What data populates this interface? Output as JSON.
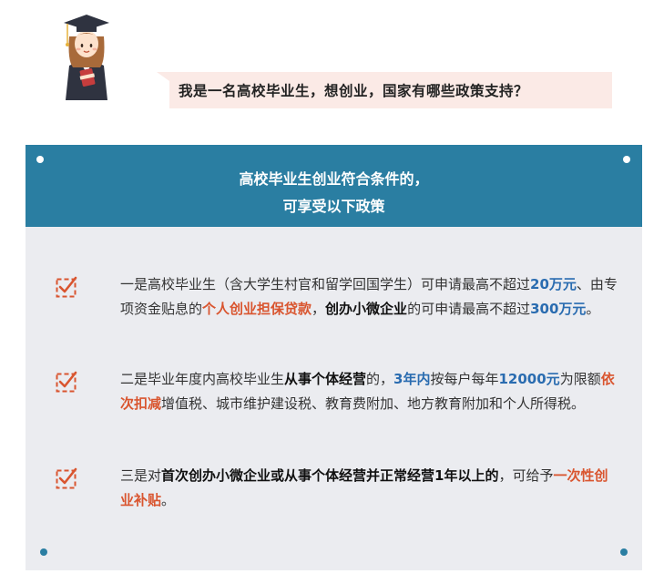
{
  "question": "我是一名高校毕业生，想创业，国家有哪些政策支持？",
  "card": {
    "title_line1": "高校毕业生创业符合条件的，",
    "title_line2": "可享受以下政策"
  },
  "items": [
    {
      "segments": [
        {
          "t": "一是高校毕业生（含大学生村官和留学回国学生）可申请最高不超过",
          "s": ""
        },
        {
          "t": "20万元",
          "s": "blue"
        },
        {
          "t": "、由专项资金贴息的",
          "s": ""
        },
        {
          "t": "个人创业担保贷款",
          "s": "red"
        },
        {
          "t": "，",
          "s": ""
        },
        {
          "t": "创办小微企业",
          "s": "bold"
        },
        {
          "t": "的可申请最高不超过",
          "s": ""
        },
        {
          "t": "300万元",
          "s": "blue"
        },
        {
          "t": "。",
          "s": ""
        }
      ]
    },
    {
      "segments": [
        {
          "t": "二是毕业年度内高校毕业生",
          "s": ""
        },
        {
          "t": "从事个体经营",
          "s": "bold"
        },
        {
          "t": "的，",
          "s": ""
        },
        {
          "t": "3年内",
          "s": "blue"
        },
        {
          "t": "按每户每年",
          "s": ""
        },
        {
          "t": "12000元",
          "s": "blue"
        },
        {
          "t": "为限额",
          "s": ""
        },
        {
          "t": "依次扣减",
          "s": "red"
        },
        {
          "t": "增值税、城市维护建设税、教育费附加、地方教育附加和个人所得税。",
          "s": ""
        }
      ]
    },
    {
      "segments": [
        {
          "t": "三是对",
          "s": ""
        },
        {
          "t": "首次创办小微企业或从事个体经营并正常经营1年以上的",
          "s": "bold"
        },
        {
          "t": "，可给予",
          "s": ""
        },
        {
          "t": "一次性创业补贴",
          "s": "red"
        },
        {
          "t": "。",
          "s": ""
        }
      ]
    }
  ],
  "colors": {
    "header_bg": "#2a7ea2",
    "card_bg": "#ebecf0",
    "accent_red": "#d9552f",
    "accent_blue": "#2a6cb0",
    "bubble_bg": "#fbeae6"
  }
}
